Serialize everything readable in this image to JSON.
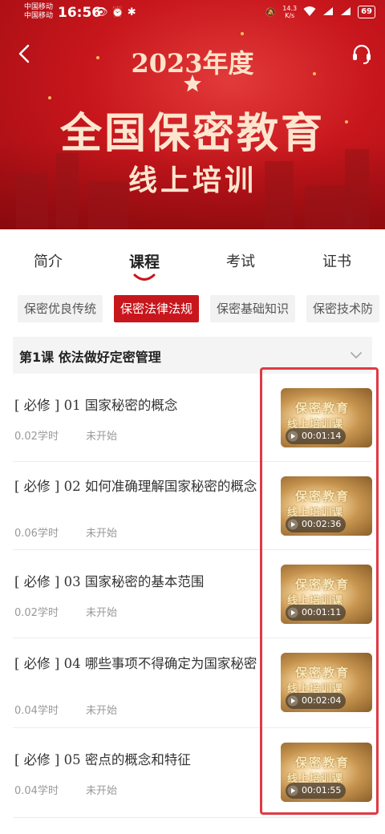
{
  "status_bar": {
    "carrier1": "中国移动",
    "carrier2": "中国移动",
    "time": "16:56",
    "net_speed_value": "14.3",
    "net_speed_unit": "K/s",
    "battery": "69"
  },
  "banner": {
    "year": "2023年度",
    "title": "全国保密教育",
    "subtitle": "线上培训"
  },
  "main_tabs": [
    {
      "label": "简介"
    },
    {
      "label": "课程"
    },
    {
      "label": "考试"
    },
    {
      "label": "证书"
    }
  ],
  "chips": [
    {
      "label": "保密优良传统"
    },
    {
      "label": "保密法律法规"
    },
    {
      "label": "保密基础知识"
    },
    {
      "label": "保密技术防"
    }
  ],
  "lesson": {
    "title": "第1课  依法做好定密管理"
  },
  "courses": [
    {
      "title": "[ 必修 ] 01  国家秘密的概念",
      "hours": "0.02学时",
      "status": "未开始",
      "duration": "00:01:14",
      "thumb_line1": "保密教育",
      "thumb_line2": "线上培训课"
    },
    {
      "title": "[ 必修 ] 02  如何准确理解国家秘密的概念",
      "hours": "0.06学时",
      "status": "未开始",
      "duration": "00:02:36",
      "thumb_line1": "保密教育",
      "thumb_line2": "线上培训课"
    },
    {
      "title": "[ 必修 ] 03  国家秘密的基本范围",
      "hours": "0.02学时",
      "status": "未开始",
      "duration": "00:01:11",
      "thumb_line1": "保密教育",
      "thumb_line2": "线上培训课"
    },
    {
      "title": "[ 必修 ] 04  哪些事项不得确定为国家秘密",
      "hours": "0.04学时",
      "status": "未开始",
      "duration": "00:02:04",
      "thumb_line1": "保密教育",
      "thumb_line2": "线上培训课"
    },
    {
      "title": "[ 必修 ] 05  密点的概念和特征",
      "hours": "0.04学时",
      "status": "未开始",
      "duration": "00:01:55",
      "thumb_line1": "保密教育",
      "thumb_line2": "线上培训课"
    }
  ],
  "colors": {
    "brand_red": "#c8161d",
    "highlight": "#e03a44"
  }
}
